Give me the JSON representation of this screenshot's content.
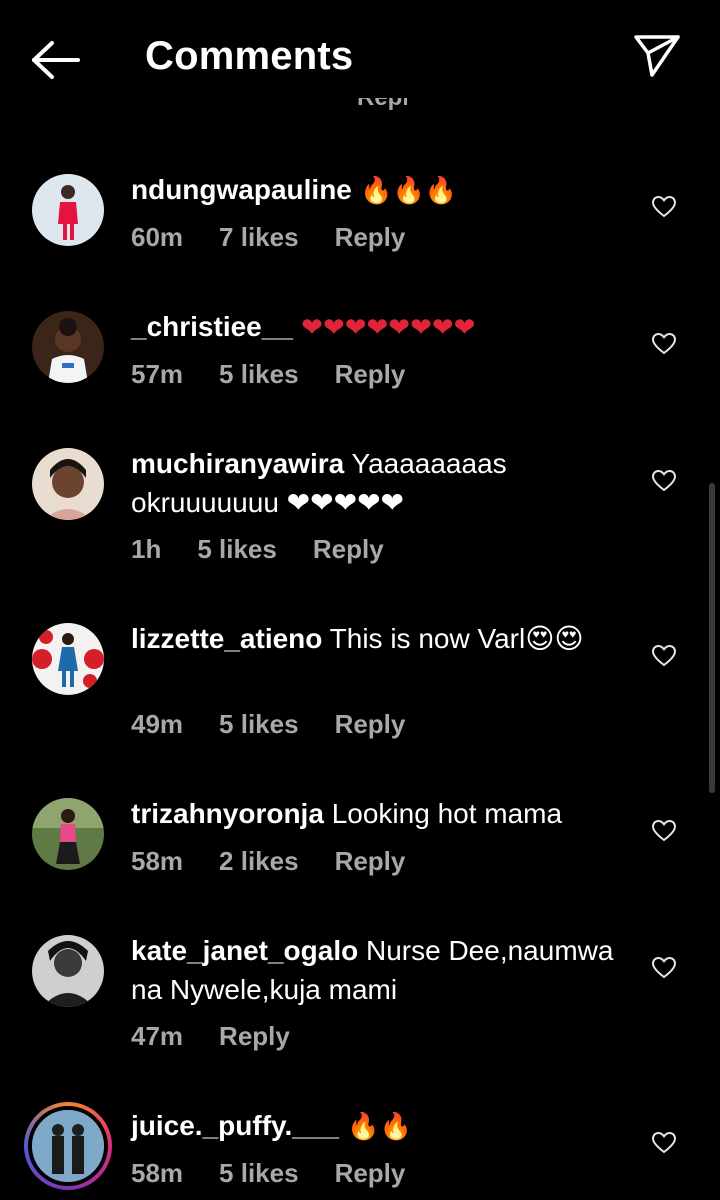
{
  "header": {
    "title": "Comments"
  },
  "ghost_reply": "Reply",
  "comments": [
    {
      "username": "ndungwapauline",
      "text": " 🔥🔥🔥",
      "time": "60m",
      "likes": "7 likes",
      "reply": "Reply"
    },
    {
      "username": "_christiee__",
      "text": " ❤❤❤❤❤❤❤❤",
      "time": "57m",
      "likes": "5 likes",
      "reply": "Reply"
    },
    {
      "username": "muchiranyawira",
      "text": " Yaaaaaaaas okruuuuuuu ❤❤❤❤❤",
      "time": "1h",
      "likes": "5 likes",
      "reply": "Reply"
    },
    {
      "username": "lizzette_atieno",
      "text": " This is now Varl😍😍",
      "time": "49m",
      "likes": "5 likes",
      "reply": "Reply"
    },
    {
      "username": "trizahnyoronja",
      "text": " Looking hot mama",
      "time": "58m",
      "likes": "2 likes",
      "reply": "Reply"
    },
    {
      "username": "kate_janet_ogalo",
      "text": " Nurse Dee,naumwa na Nywele,kuja mami",
      "time": "47m",
      "likes": "",
      "reply": "Reply"
    },
    {
      "username": "juice._puffy.___",
      "text": " 🔥🔥",
      "time": "58m",
      "likes": "5 likes",
      "reply": "Reply"
    }
  ],
  "colors": {
    "background": "#000000",
    "text": "#ffffff",
    "muted": "#a8a8a8",
    "heart_red": "#e0243a",
    "fire": "#ff8a1a"
  }
}
